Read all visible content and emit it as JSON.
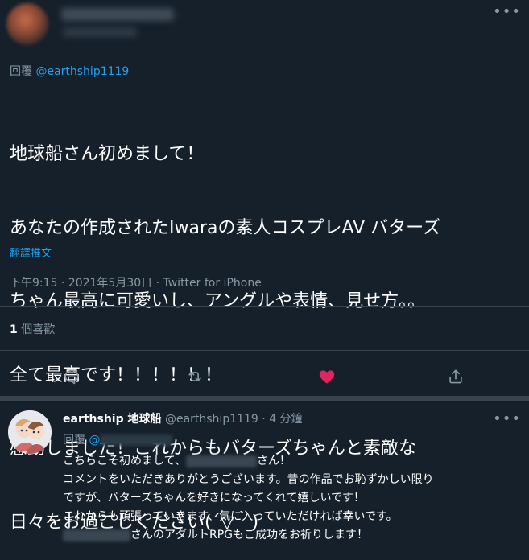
{
  "header": {
    "more_icon": "more-dots-icon"
  },
  "tweet": {
    "reply_prefix": "回覆",
    "reply_handle": "@earthship1119",
    "lines": [
      "地球船さん初めまして！",
      "あなたの作成されたIwaraの素人コスプレAV バターズ",
      "ちゃん最高に可愛いし、アングルや表情、見せ方。。",
      "全て最高です！！！！！！",
      "感動しました！これからもバターズちゃんと素敵な",
      "日々をお過ごしください(´▽｀)"
    ],
    "translate_label": "翻譯推文",
    "timestamp": "下午9:15 · 2021年5月30日 · Twitter for iPhone",
    "like_count": "1",
    "like_label": " 個喜歡",
    "actions": [
      "reply-icon",
      "retweet-icon",
      "like-icon-filled",
      "share-icon"
    ],
    "like_color": "#e0245e"
  },
  "reply": {
    "name": "earthship 地球船",
    "handle": "@earthship1119",
    "time": "· 4 分鐘",
    "reply_prefix": "回覆",
    "reply_handle": "@",
    "lines": {
      "l1a": "こちらこそ初めまして、",
      "l1b": "さん！",
      "l2": "コメントをいただきありがとうございます。昔の作品でお恥ずかしい限り",
      "l3": "ですが、バターズちゃんを好きになってくれて嬉しいです！",
      "l4": "これからも頑張っていきます、気に入っていただければ幸いです。",
      "l5": "さんのアダルトRPGもご成功をお祈りします！"
    }
  },
  "colors": {
    "background": "#15202b",
    "muted": "#8899a6",
    "accent": "#1da1f2",
    "divider": "#38444d"
  }
}
